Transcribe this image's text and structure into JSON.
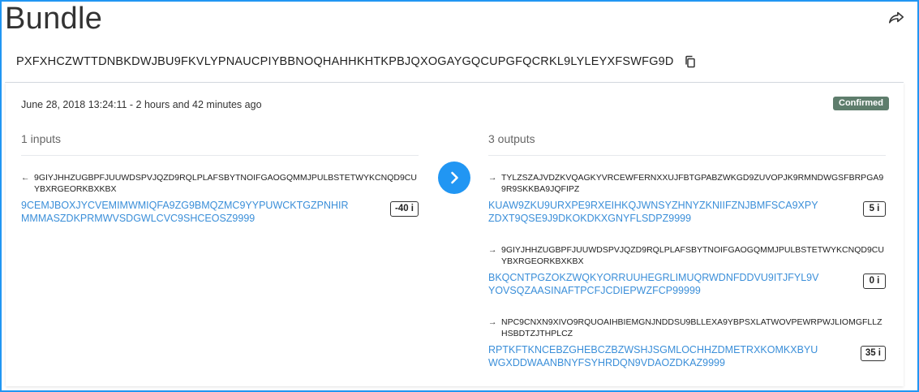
{
  "bundle": {
    "title": "Bundle",
    "hash": "PXFXHCZWTTDNBKDWJBU9FKVLYPNAUCPIYBBNOQHAHHKHTKPBJQXOGAYGQCUPGFQCRKL9LYLEYXFSWFG9D"
  },
  "details": {
    "timestamp": "June 28, 2018 13:24:11 - 2 hours and 42 minutes ago",
    "status": "Confirmed"
  },
  "inputs": {
    "header": "1 inputs",
    "items": [
      {
        "address": "9GIYJHHZUGBPFJUUWDSPVJQZD9RQLPLAFSBYTNOIFGAOGQMMJPULBSTETWYKCNQD9CUYBXRGEORKBXKBX",
        "hash": "9CEMJBOXJYCVEMIMWMIQFA9ZG9BMQZMC9YYPUWCKTGZPNHIRMMMASZDKPRMWVSDGWLCVC9SHCEOSZ9999",
        "value": "-40 i"
      }
    ]
  },
  "outputs": {
    "header": "3 outputs",
    "items": [
      {
        "address": "TYLZSZAJVDZKVQAGKYVRCEWFERNXXUJFBTGPABZWKGD9ZUVOPJK9RMNDWGSFBRPGA99R9SKKBA9JQFIPZ",
        "hash": "KUAW9ZKU9URXPE9RXEIHKQJWNSYZHNYZKNIIFZNJBMFSCA9XPYZDXT9QSE9J9DKOKDKXGNYFLSDPZ9999",
        "value": "5 i"
      },
      {
        "address": "9GIYJHHZUGBPFJUUWDSPVJQZD9RQLPLAFSBYTNOIFGAOGQMMJPULBSTETWYKCNQD9CUYBXRGEORKBXKBX",
        "hash": "BKQCNTPGZOKZWQKYORRUUHEGRLIMUQRWDNFDDVU9ITJFYL9VYOVSQZAASINAFTPCFJCDIEPWZFCP99999",
        "value": "0 i"
      },
      {
        "address": "NPC9CNXN9XIVO9RQUOAIHBIEMGNJNDDSU9BLLEXA9YBPSXLATWOVPEWRPWJLIOMGFLLZHSBDTZJTHPLCZ",
        "hash": "RPTKFTKNCEBZGHEBCZBZWSHJSGMLOCHHZDMETRXKOMKXBYUWGXDDWAANBNYFSYHRDQN9VDAOZDKAZ9999",
        "value": "35 i"
      }
    ]
  },
  "icons": {
    "share": "share-icon",
    "copy": "copy-icon",
    "in_arrow": "arrow-left-icon",
    "out_arrow": "arrow-right-icon",
    "flow": "chevron-right-icon"
  },
  "colors": {
    "accent": "#2196f3",
    "link": "#3b8fd9",
    "badge": "#5e7d6c"
  }
}
